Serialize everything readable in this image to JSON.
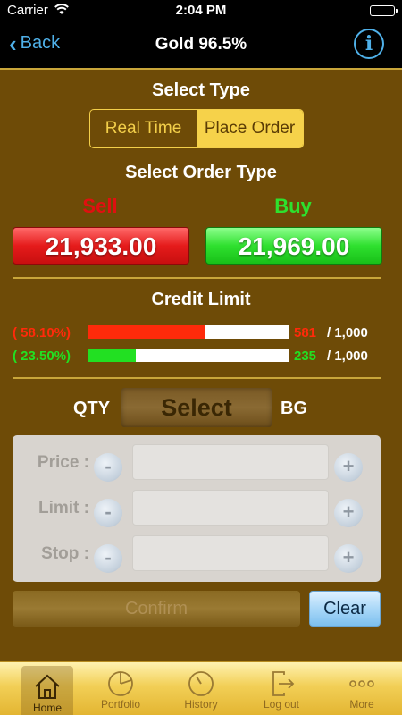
{
  "status_bar": {
    "carrier": "Carrier",
    "time": "2:04 PM"
  },
  "nav": {
    "back_label": "Back",
    "title": "Gold 96.5%",
    "info_glyph": "i"
  },
  "select_type": {
    "heading": "Select Type",
    "options": [
      "Real Time",
      "Place Order"
    ],
    "selected": "Place Order"
  },
  "order_type": {
    "heading": "Select Order Type",
    "sell_label": "Sell",
    "sell_price": "21,933.00",
    "buy_label": "Buy",
    "buy_price": "21,969.00",
    "sell_color": "#e01010",
    "buy_color": "#2ee02e"
  },
  "credit_limit": {
    "heading": "Credit Limit",
    "rows": [
      {
        "percent": "( 58.10%)",
        "fill": 0.581,
        "used": "581",
        "total": "/ 1,000",
        "color": "#ff2a0a"
      },
      {
        "percent": "( 23.50%)",
        "fill": 0.235,
        "used": "235",
        "total": "/ 1,000",
        "color": "#22e022"
      }
    ]
  },
  "qty": {
    "label": "QTY",
    "select_label": "Select",
    "unit": "BG"
  },
  "order_fields": {
    "price_label": "Price :",
    "limit_label": "Limit :",
    "stop_label": "Stop :",
    "minus": "-",
    "plus": "+"
  },
  "actions": {
    "confirm": "Confirm",
    "clear": "Clear"
  },
  "tabs": [
    {
      "label": "Home",
      "icon": "home-icon",
      "active": true
    },
    {
      "label": "Portfolio",
      "icon": "pie-chart-icon",
      "active": false
    },
    {
      "label": "History",
      "icon": "clock-icon",
      "active": false
    },
    {
      "label": "Log out",
      "icon": "logout-icon",
      "active": false
    },
    {
      "label": "More",
      "icon": "more-icon",
      "active": false
    }
  ],
  "colors": {
    "accent": "#4fb0e8",
    "background": "#6e4b07",
    "gold": "#f3cf4a"
  }
}
